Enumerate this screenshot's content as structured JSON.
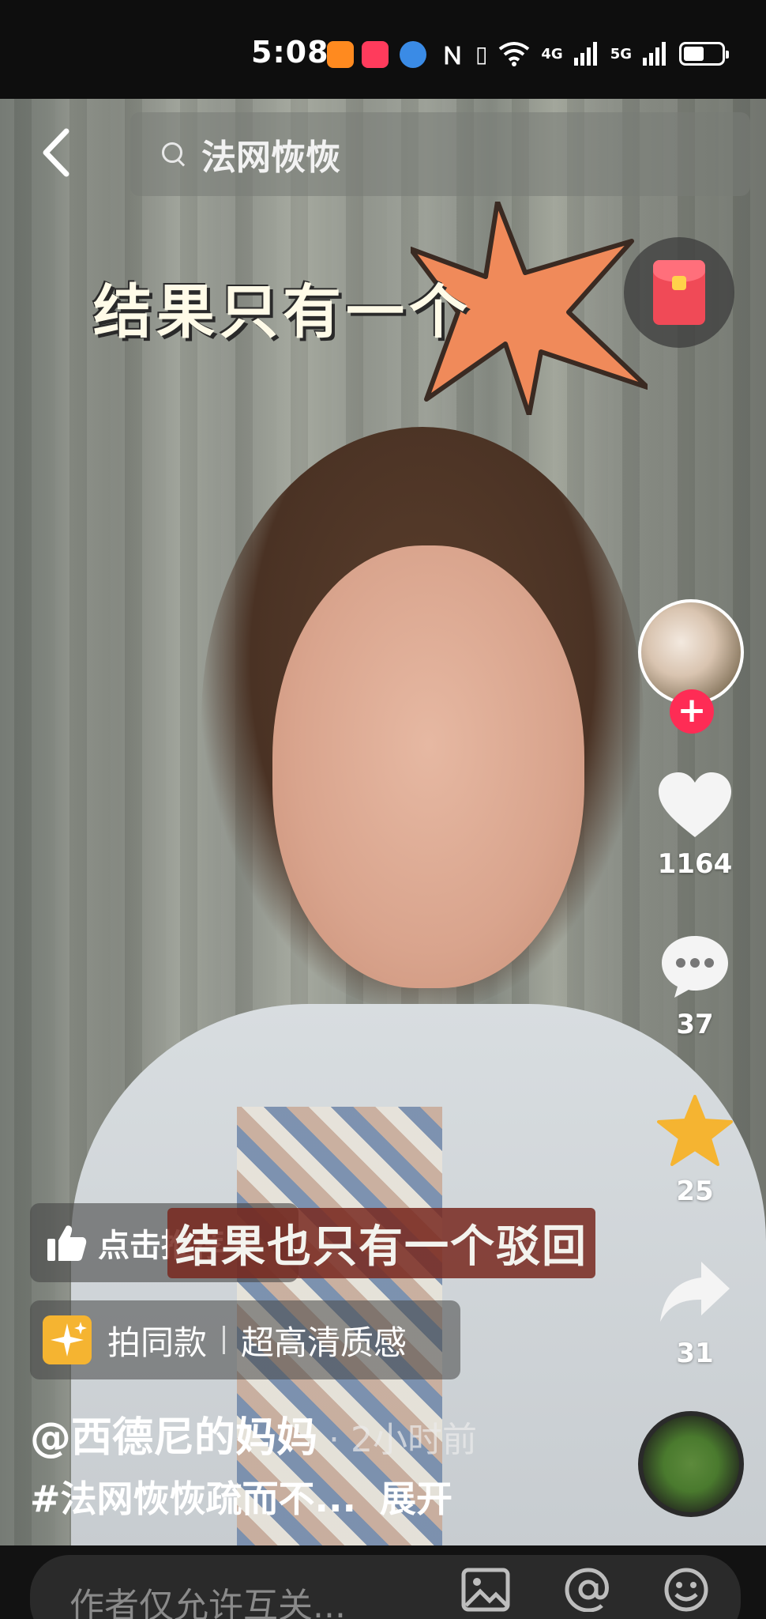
{
  "status_bar": {
    "time": "5:08",
    "network_a": "4G",
    "network_b": "5G",
    "battery_level": 0.55
  },
  "search": {
    "query": "法网恢恢"
  },
  "overlay": {
    "title": "结果只有一个"
  },
  "actions": {
    "likes": "1164",
    "comments": "37",
    "favorites": "25",
    "shares": "31"
  },
  "recommend": {
    "label": "点击推荐",
    "arrow": ">"
  },
  "subtitle": "结果也只有一个驳回",
  "template": {
    "label": "拍同款",
    "quality": "超高清质感"
  },
  "author": {
    "name": "@西德尼的妈妈",
    "time": "· 2小时前"
  },
  "description": {
    "text": "#法网恢恢疏而不...",
    "expand": "展开"
  },
  "comment_bar": {
    "placeholder": "作者仅允许互关..."
  },
  "colors": {
    "accent_red": "#fe2c55",
    "star_yellow": "#f5b431",
    "burst_orange": "#f08a5a"
  }
}
